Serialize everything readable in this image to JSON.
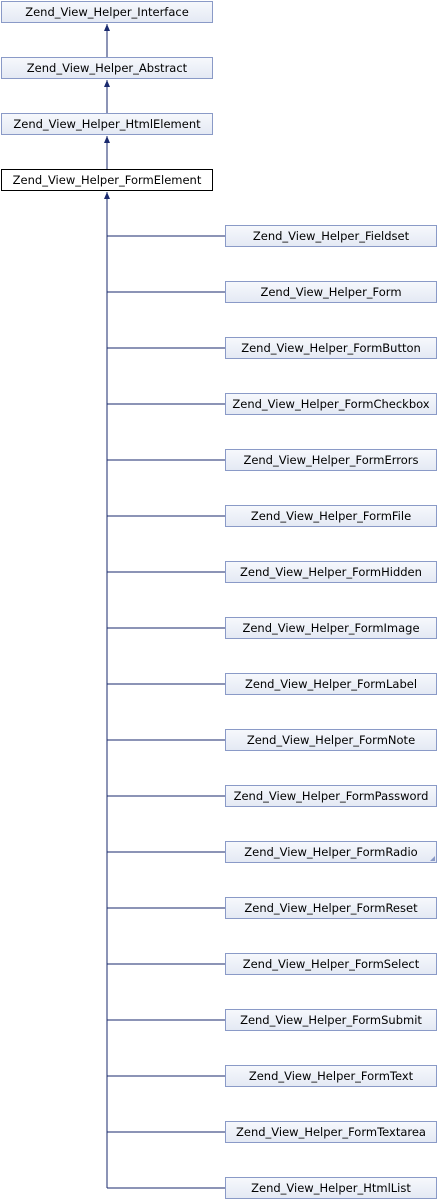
{
  "ancestors": [
    "Zend_View_Helper_Interface",
    "Zend_View_Helper_Abstract",
    "Zend_View_Helper_HtmlElement"
  ],
  "current": "Zend_View_Helper_FormElement",
  "children": [
    "Zend_View_Helper_Fieldset",
    "Zend_View_Helper_Form",
    "Zend_View_Helper_FormButton",
    "Zend_View_Helper_FormCheckbox",
    "Zend_View_Helper_FormErrors",
    "Zend_View_Helper_FormFile",
    "Zend_View_Helper_FormHidden",
    "Zend_View_Helper_FormImage",
    "Zend_View_Helper_FormLabel",
    "Zend_View_Helper_FormNote",
    "Zend_View_Helper_FormPassword",
    "Zend_View_Helper_FormRadio",
    "Zend_View_Helper_FormReset",
    "Zend_View_Helper_FormSelect",
    "Zend_View_Helper_FormSubmit",
    "Zend_View_Helper_FormText",
    "Zend_View_Helper_FormTextarea",
    "Zend_View_Helper_HtmlList"
  ],
  "folded_child": "Zend_View_Helper_FormRadio",
  "colors": {
    "node_border": "#8a9ac7",
    "edge": "#1a2a6e",
    "current_border": "#000000"
  }
}
